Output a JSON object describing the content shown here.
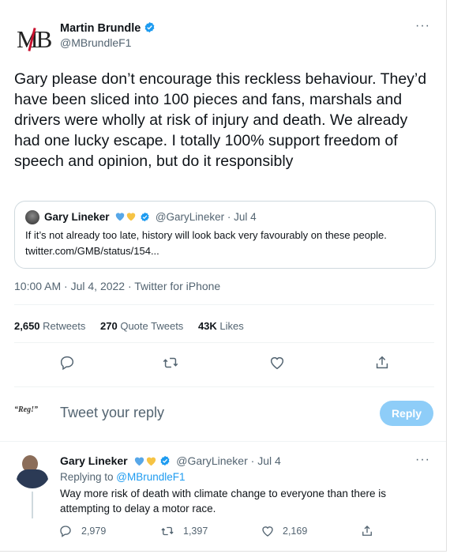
{
  "main_tweet": {
    "avatar_text": "MB",
    "author_name": "Martin Brundle",
    "handle": "@MBrundleF1",
    "more": "···",
    "text": "Gary please don’t encourage this reckless behaviour. They’d have been sliced into 100 pieces and fans, marshals and drivers were wholly at risk of injury and death. We already had one lucky escape. I totally 100% support freedom of speech and opinion, but do it responsibly",
    "timestamp": "10:00 AM · Jul 4, 2022 · ",
    "source": "Twitter for iPhone"
  },
  "quoted_tweet": {
    "author_name": "Gary Lineker",
    "handle_date": "@GaryLineker · Jul 4",
    "text": "If it’s not already too late, history will look back very favourably on these people.",
    "link": "twitter.com/GMB/status/154..."
  },
  "stats": {
    "retweets_count": "2,650",
    "retweets_label": "Retweets",
    "quotes_count": "270",
    "quotes_label": "Quote Tweets",
    "likes_count": "43K",
    "likes_label": "Likes"
  },
  "reply_composer": {
    "avatar_text": "“Reg!”",
    "placeholder": "Tweet your reply",
    "button_label": "Reply"
  },
  "reply_tweet": {
    "author_name": "Gary Lineker",
    "handle_date": "@GaryLineker · Jul 4",
    "replying_prefix": "Replying to ",
    "replying_to": "@MBrundleF1",
    "text_line1": "Way more risk of death with climate change to everyone than there is",
    "text_line2": "attempting to delay a motor race.",
    "more": "···",
    "replies": "2,979",
    "retweets": "1,397",
    "likes": "2,169"
  },
  "colors": {
    "verified_blue": "#1d9bf0",
    "link_blue": "#1d9bf0",
    "heart_blue": "#57a7e8",
    "heart_yellow": "#f6c344",
    "muted_text": "#536471",
    "reply_button": "#8ecdf8"
  },
  "icons": [
    "verified-badge-icon",
    "reply-icon",
    "retweet-icon",
    "like-icon",
    "share-icon",
    "blue-heart-icon",
    "yellow-heart-icon"
  ]
}
